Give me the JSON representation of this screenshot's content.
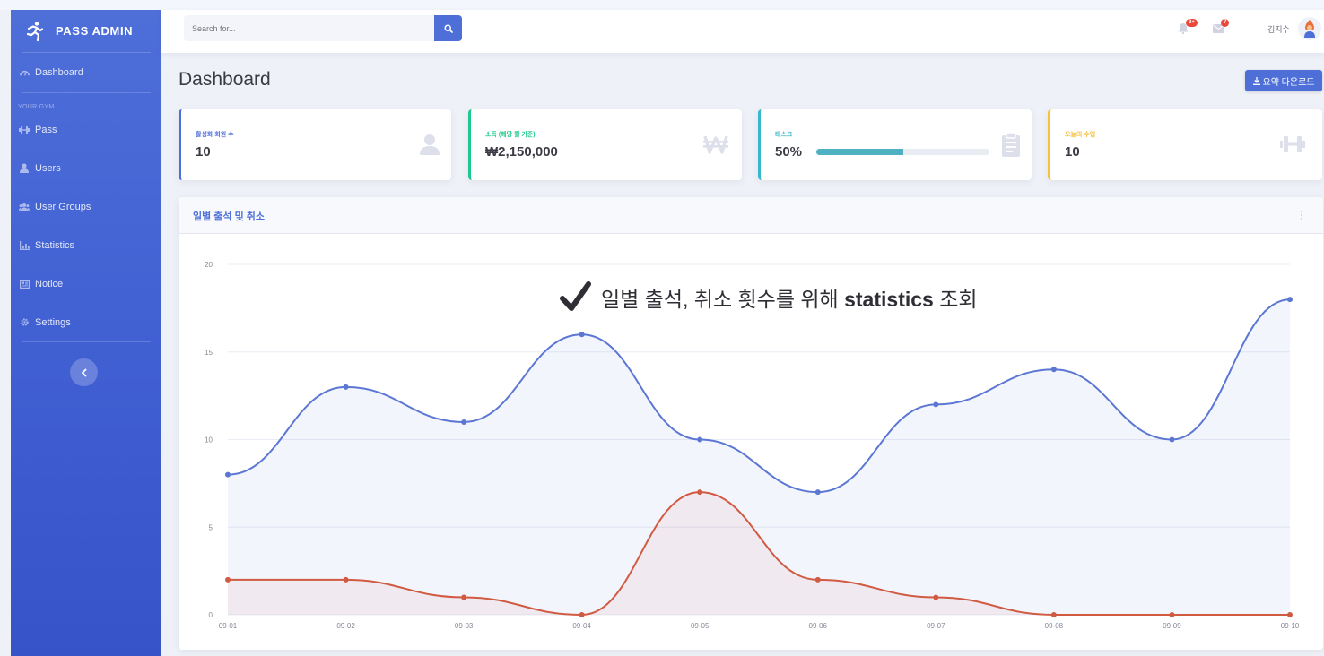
{
  "brand": {
    "name": "PASS ADMIN",
    "icon": "runner-icon"
  },
  "sidebar": {
    "dashboard": "Dashboard",
    "section_heading": "YOUR GYM",
    "items": [
      {
        "label": "Pass",
        "icon": "dumbbell-icon"
      },
      {
        "label": "Users",
        "icon": "user-icon"
      },
      {
        "label": "User Groups",
        "icon": "users-icon"
      },
      {
        "label": "Statistics",
        "icon": "bar-chart-icon"
      },
      {
        "label": "Notice",
        "icon": "newspaper-icon"
      },
      {
        "label": "Settings",
        "icon": "gear-icon"
      }
    ],
    "toggle_icon": "chevron-left-icon"
  },
  "topbar": {
    "search_placeholder": "Search for...",
    "alerts_badge": "3+",
    "messages_badge": "7",
    "username": "김지수"
  },
  "page": {
    "title": "Dashboard",
    "download_label": "요약 다운로드"
  },
  "cards": [
    {
      "label": "활성화 회원 수",
      "value": "10",
      "color": "#4e6fd8",
      "icon": "user-icon"
    },
    {
      "label": "소득 (해당 월 기준)",
      "value": "₩2,150,000",
      "color": "#1cc88a",
      "icon": "won-icon"
    },
    {
      "label": "태스크",
      "value": "50%",
      "color": "#36b9cc",
      "icon": "clipboard-icon",
      "progress": 0.5
    },
    {
      "label": "오늘의 수업",
      "value": "10",
      "color": "#f6c23e",
      "icon": "dumbbell-icon"
    }
  ],
  "chart_card": {
    "title": "일별 출석 및 취소"
  },
  "annotation": {
    "text_before": "일별 출석, 취소 횟수를 위해",
    "text_bold": "statistics",
    "text_after": "조회"
  },
  "chart_data": {
    "type": "area",
    "categories": [
      "09-01",
      "09-02",
      "09-03",
      "09-04",
      "09-05",
      "09-06",
      "09-07",
      "09-08",
      "09-09",
      "09-10"
    ],
    "series": [
      {
        "values": [
          8,
          13,
          11,
          16,
          10,
          7,
          12,
          14,
          10,
          18
        ],
        "color": "#5b77d3"
      },
      {
        "values": [
          2,
          2,
          1,
          0,
          7,
          2,
          1,
          0,
          0,
          0
        ],
        "color": "#d15a42"
      }
    ],
    "ylim": [
      0,
      20
    ],
    "yticks": [
      "0",
      "5",
      "10",
      "15",
      "20"
    ],
    "grid": true,
    "smooth": true
  }
}
